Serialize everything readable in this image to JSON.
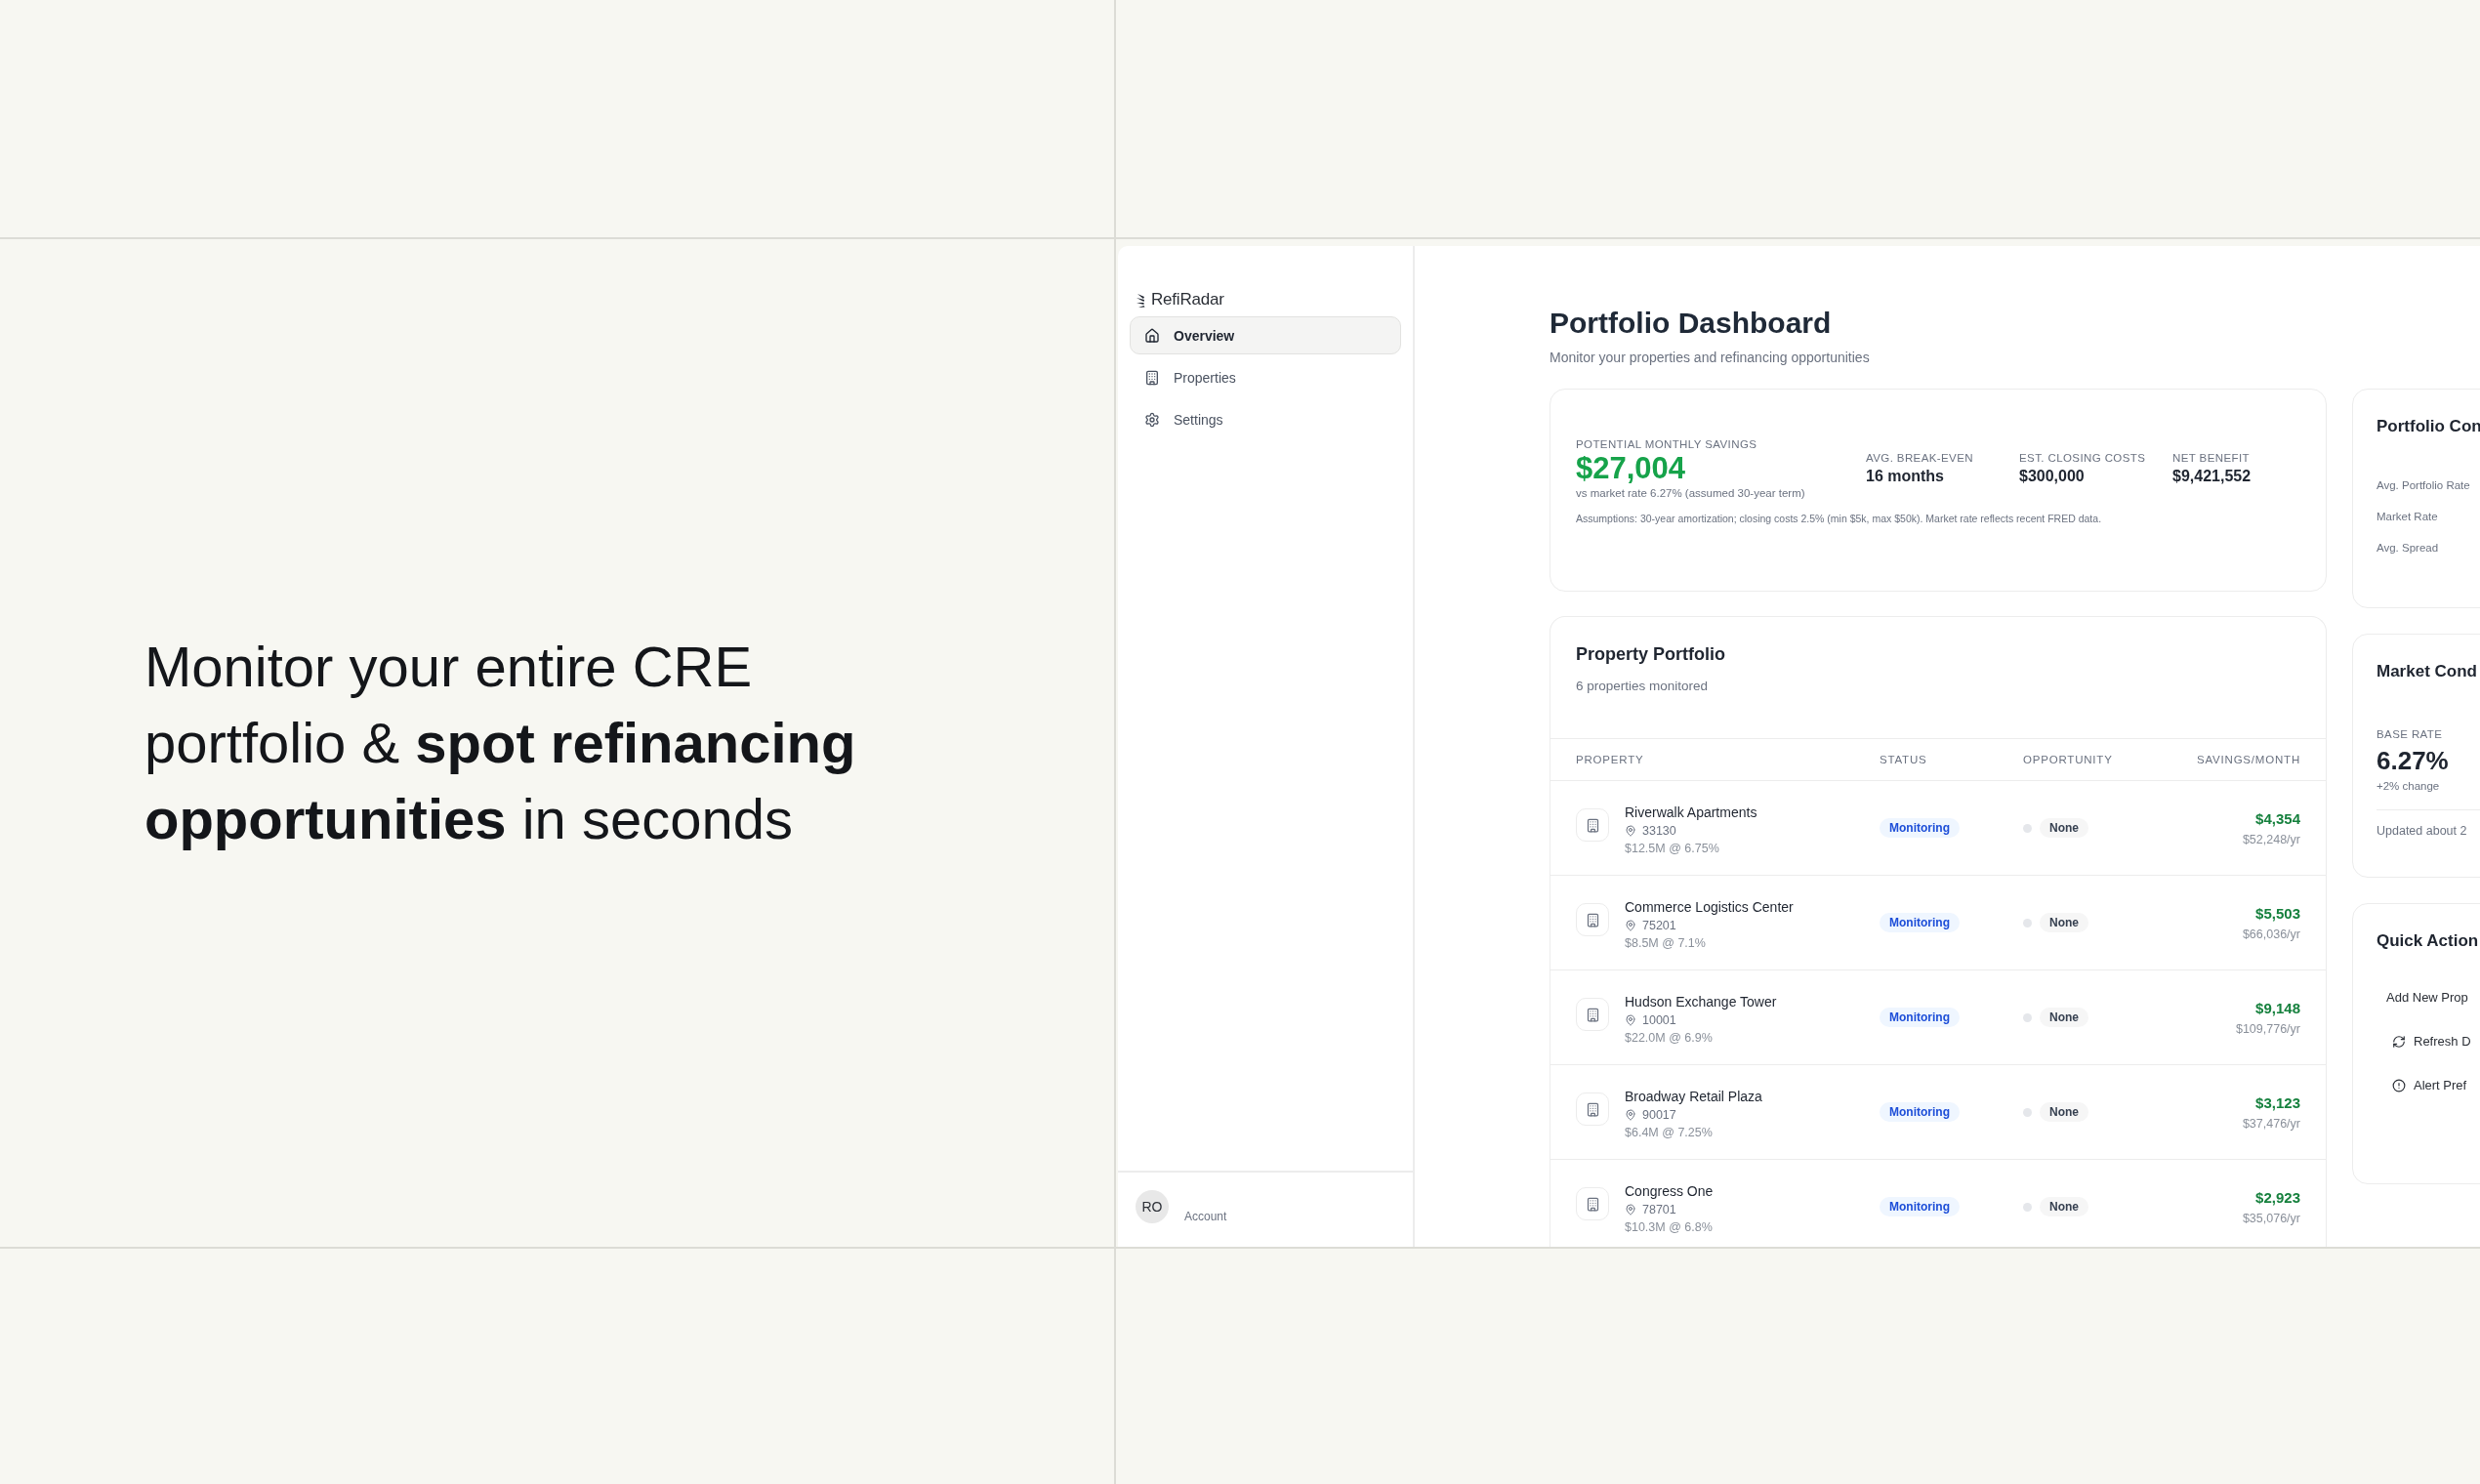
{
  "hero": {
    "text": "Monitor your entire CRE portfolio & **spot refinancing opportunities** in seconds"
  },
  "sidebar": {
    "brand": "RefiRadar",
    "items": [
      {
        "label": "Overview",
        "kind": "home",
        "selected": true
      },
      {
        "label": "Properties",
        "kind": "building",
        "selected": false
      },
      {
        "label": "Settings",
        "kind": "gear",
        "selected": false
      }
    ],
    "account": {
      "initials": "RO",
      "label": "Account"
    }
  },
  "header": {
    "title": "Portfolio Dashboard",
    "subtitle": "Monitor your properties and refinancing opportunities"
  },
  "savings": {
    "label": "POTENTIAL MONTHLY SAVINGS",
    "value": "$27,004",
    "note": "vs market rate 6.27% (assumed 30-year term)",
    "stats": [
      {
        "label": "AVG. BREAK-EVEN",
        "value": "16 months"
      },
      {
        "label": "EST. CLOSING COSTS",
        "value": "$300,000"
      },
      {
        "label": "NET BENEFIT",
        "value": "$9,421,552"
      }
    ],
    "assumptions": "Assumptions: 30-year amortization; closing costs 2.5% (min $5k, max $50k). Market rate reflects recent FRED data."
  },
  "portfolio": {
    "title": "Property Portfolio",
    "subtitle": "6 properties monitored",
    "columns": [
      "PROPERTY",
      "STATUS",
      "OPPORTUNITY",
      "SAVINGS/MONTH"
    ],
    "rows": [
      {
        "name": "Riverwalk Apartments",
        "zip": "33130",
        "loan": "$12.5M @ 6.75%",
        "status": "Monitoring",
        "opportunity": "None",
        "savings": "$4,354",
        "annual": "$52,248/yr"
      },
      {
        "name": "Commerce Logistics Center",
        "zip": "75201",
        "loan": "$8.5M @ 7.1%",
        "status": "Monitoring",
        "opportunity": "None",
        "savings": "$5,503",
        "annual": "$66,036/yr"
      },
      {
        "name": "Hudson Exchange Tower",
        "zip": "10001",
        "loan": "$22.0M @ 6.9%",
        "status": "Monitoring",
        "opportunity": "None",
        "savings": "$9,148",
        "annual": "$109,776/yr"
      },
      {
        "name": "Broadway Retail Plaza",
        "zip": "90017",
        "loan": "$6.4M @ 7.25%",
        "status": "Monitoring",
        "opportunity": "None",
        "savings": "$3,123",
        "annual": "$37,476/yr"
      },
      {
        "name": "Congress One",
        "zip": "78701",
        "loan": "$10.3M @ 6.8%",
        "status": "Monitoring",
        "opportunity": "None",
        "savings": "$2,923",
        "annual": "$35,076/yr"
      }
    ]
  },
  "comparison": {
    "title": "Portfolio Con",
    "rows": [
      "Avg. Portfolio Rate",
      "Market Rate",
      "Avg. Spread"
    ]
  },
  "market": {
    "title": "Market Cond",
    "label": "BASE RATE",
    "value": "6.27%",
    "change": "+2% change",
    "updated": "Updated about 2"
  },
  "quick_actions": {
    "title": "Quick Action",
    "actions": [
      {
        "label": "Add New Prop",
        "kind": "plain"
      },
      {
        "label": "Refresh D",
        "kind": "refresh"
      },
      {
        "label": "Alert Pref",
        "kind": "alert"
      }
    ]
  }
}
